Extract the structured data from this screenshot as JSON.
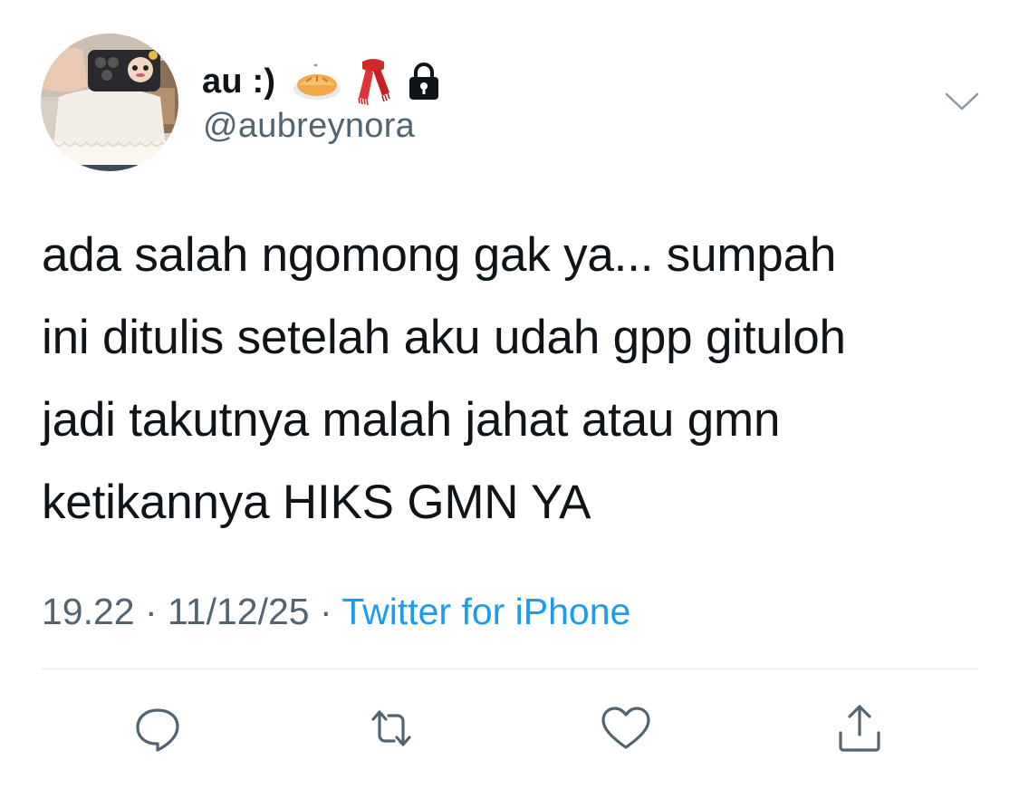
{
  "tweet": {
    "display_name": "au :)",
    "name_emojis": [
      "pie-icon",
      "scarf-icon",
      "lock-icon"
    ],
    "handle": "@aubreynora",
    "text": "ada salah ngomong gak ya... sumpah\nini ditulis setelah aku udah gpp gituloh\njadi takutnya malah jahat atau gmn\nketikannya HIKS GMN YA",
    "time": "19.22",
    "separator": " · ",
    "date": "11/12/25",
    "source": "Twitter for iPhone"
  },
  "actions": [
    "reply-icon",
    "retweet-icon",
    "like-icon",
    "share-icon"
  ],
  "colors": {
    "text": "#0f1419",
    "secondary": "#536471",
    "link": "#1d9bf0",
    "divider": "#e3e6e9"
  }
}
